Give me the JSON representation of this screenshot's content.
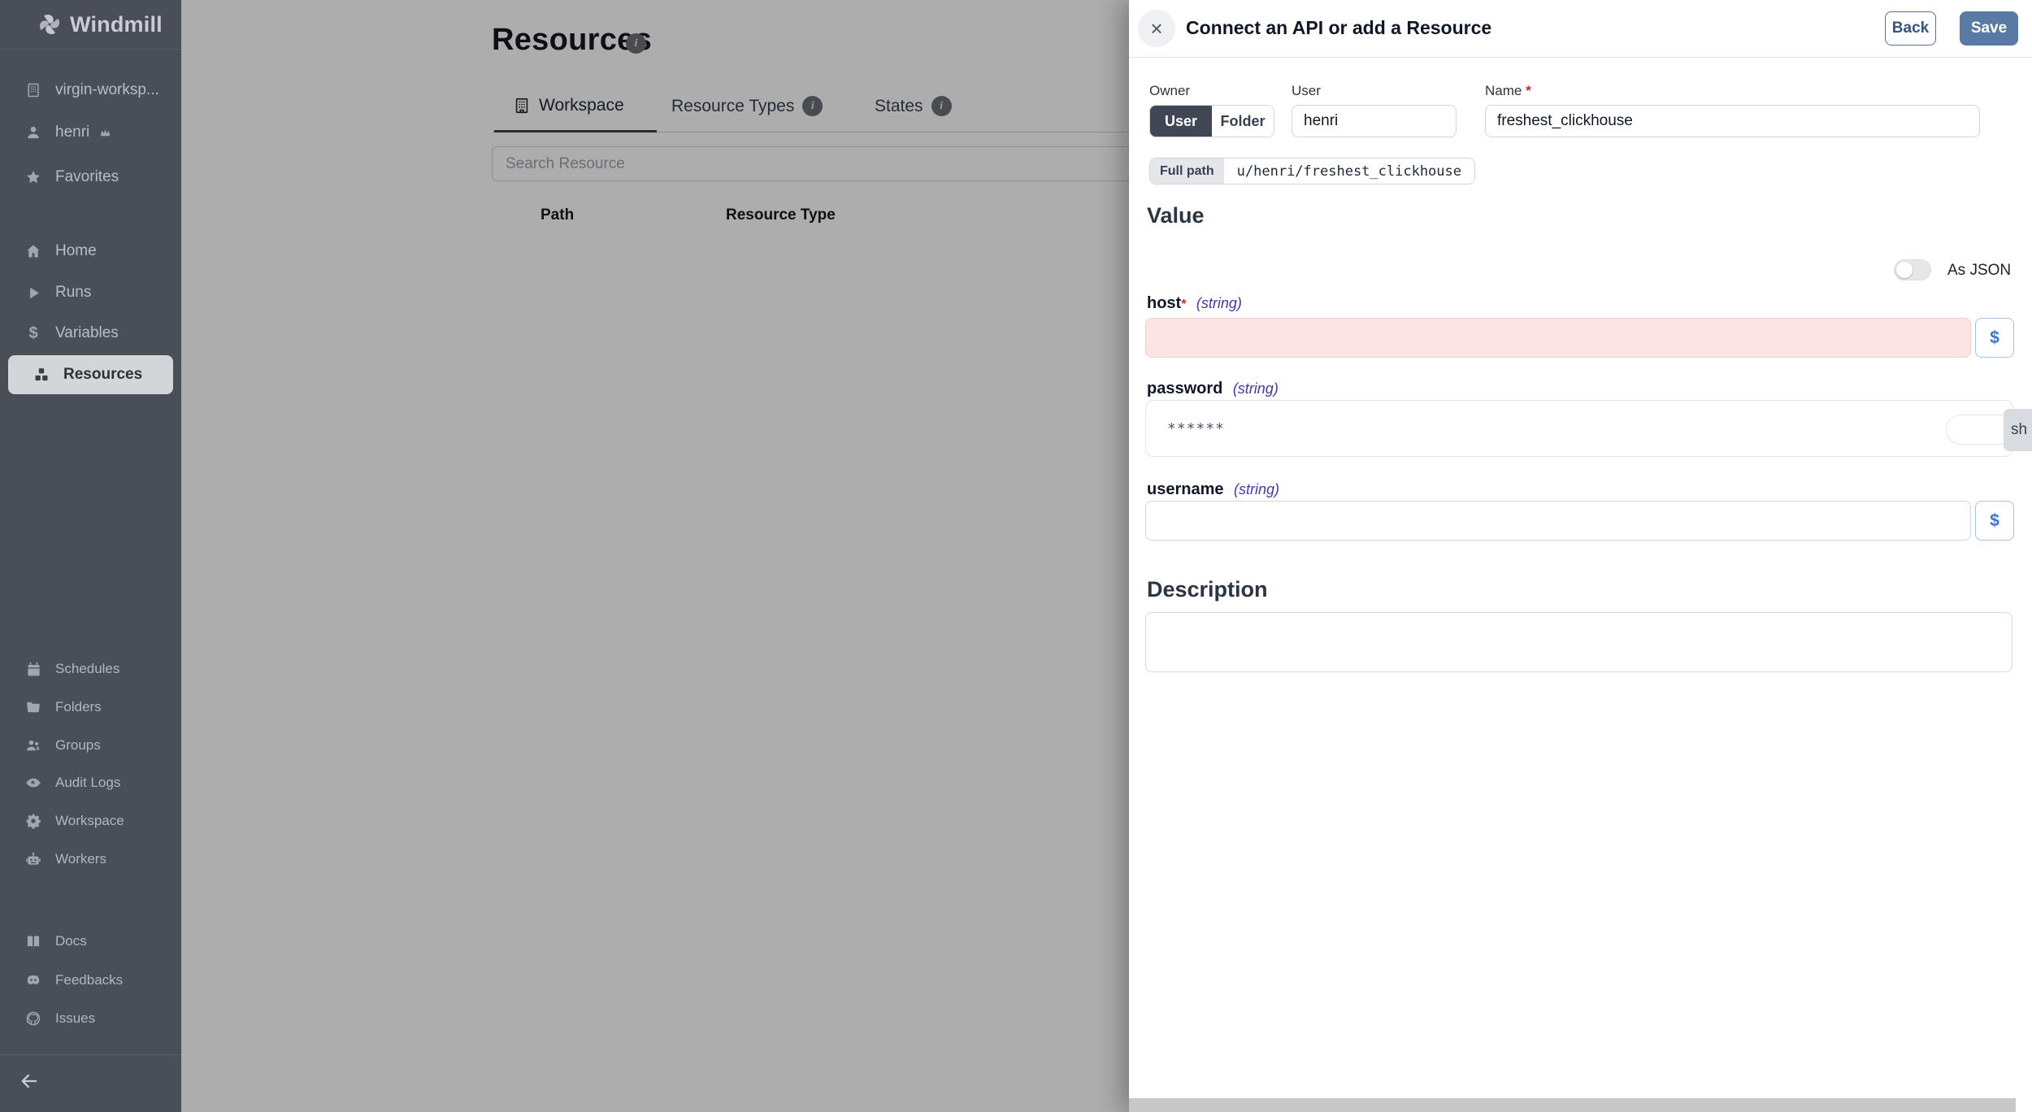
{
  "sidebar": {
    "logo_label": "Windmill",
    "logo_icon": "windmill-icon",
    "workspace_item": {
      "label": "virgin-worksp...",
      "icon": "building-icon"
    },
    "user_item": {
      "label": "henri",
      "icon": "user-icon",
      "badge_icon": "crown-icon"
    },
    "favorites_item": {
      "label": "Favorites",
      "icon": "star-icon"
    },
    "nav": [
      {
        "label": "Home",
        "icon": "home-icon",
        "active": false
      },
      {
        "label": "Runs",
        "icon": "play-icon",
        "active": false
      },
      {
        "label": "Variables",
        "icon": "dollar-icon",
        "active": false
      },
      {
        "label": "Resources",
        "icon": "boxes-icon",
        "active": true
      }
    ],
    "admin": [
      {
        "label": "Schedules",
        "icon": "calendar-icon"
      },
      {
        "label": "Folders",
        "icon": "folder-icon"
      },
      {
        "label": "Groups",
        "icon": "users-icon"
      },
      {
        "label": "Audit Logs",
        "icon": "eye-icon"
      },
      {
        "label": "Workspace",
        "icon": "gear-icon"
      },
      {
        "label": "Workers",
        "icon": "robot-icon"
      }
    ],
    "links": [
      {
        "label": "Docs",
        "icon": "book-icon"
      },
      {
        "label": "Feedbacks",
        "icon": "discord-icon"
      },
      {
        "label": "Issues",
        "icon": "github-icon"
      }
    ],
    "collapse_icon": "arrow-left-icon",
    "dollar_glyph": "$"
  },
  "main": {
    "title": "Resources",
    "tabs": [
      {
        "label": "Workspace",
        "icon": "building-icon",
        "active": true,
        "info": false
      },
      {
        "label": "Resource Types",
        "active": false,
        "info": true
      },
      {
        "label": "States",
        "active": false,
        "info": true
      }
    ],
    "search_placeholder": "Search Resource",
    "table_headers": [
      "Path",
      "Resource Type"
    ],
    "info_glyph": "i"
  },
  "drawer": {
    "title": "Connect an API or add a Resource",
    "close_glyph": "×",
    "back_label": "Back",
    "save_label": "Save",
    "owner": {
      "label": "Owner",
      "options": [
        "User",
        "Folder"
      ],
      "selected": "User"
    },
    "user_field": {
      "label": "User",
      "value": "henri"
    },
    "name_field": {
      "label": "Name",
      "required_mark": "*",
      "value": "freshest_clickhouse"
    },
    "full_path": {
      "label": "Full path",
      "value": "u/henri/freshest_clickhouse"
    },
    "value_section": {
      "heading": "Value",
      "as_json_label": "As JSON",
      "as_json_on": false
    },
    "fields": [
      {
        "name": "host",
        "type": "(string)",
        "required_mark": "*",
        "value": "",
        "invalid": true,
        "var_button": "$"
      },
      {
        "name": "password",
        "type": "(string)",
        "value": "******",
        "show_button": "sh"
      },
      {
        "name": "username",
        "type": "(string)",
        "value": "",
        "var_button": "$"
      }
    ],
    "description": {
      "heading": "Description",
      "value": ""
    }
  },
  "colors": {
    "sidebar_bg": "#4a4e57",
    "sidebar_selected_bg": "#d3d5d9",
    "save_button": "#5a7aa6",
    "back_button_text": "#35557f",
    "invalid_field_bg": "#fbe4e2",
    "type_text": "#4238ae",
    "required_star": "#cc2727",
    "overlay": "rgba(0,0,0,0.32)",
    "var_button_text": "#3b74d1"
  }
}
